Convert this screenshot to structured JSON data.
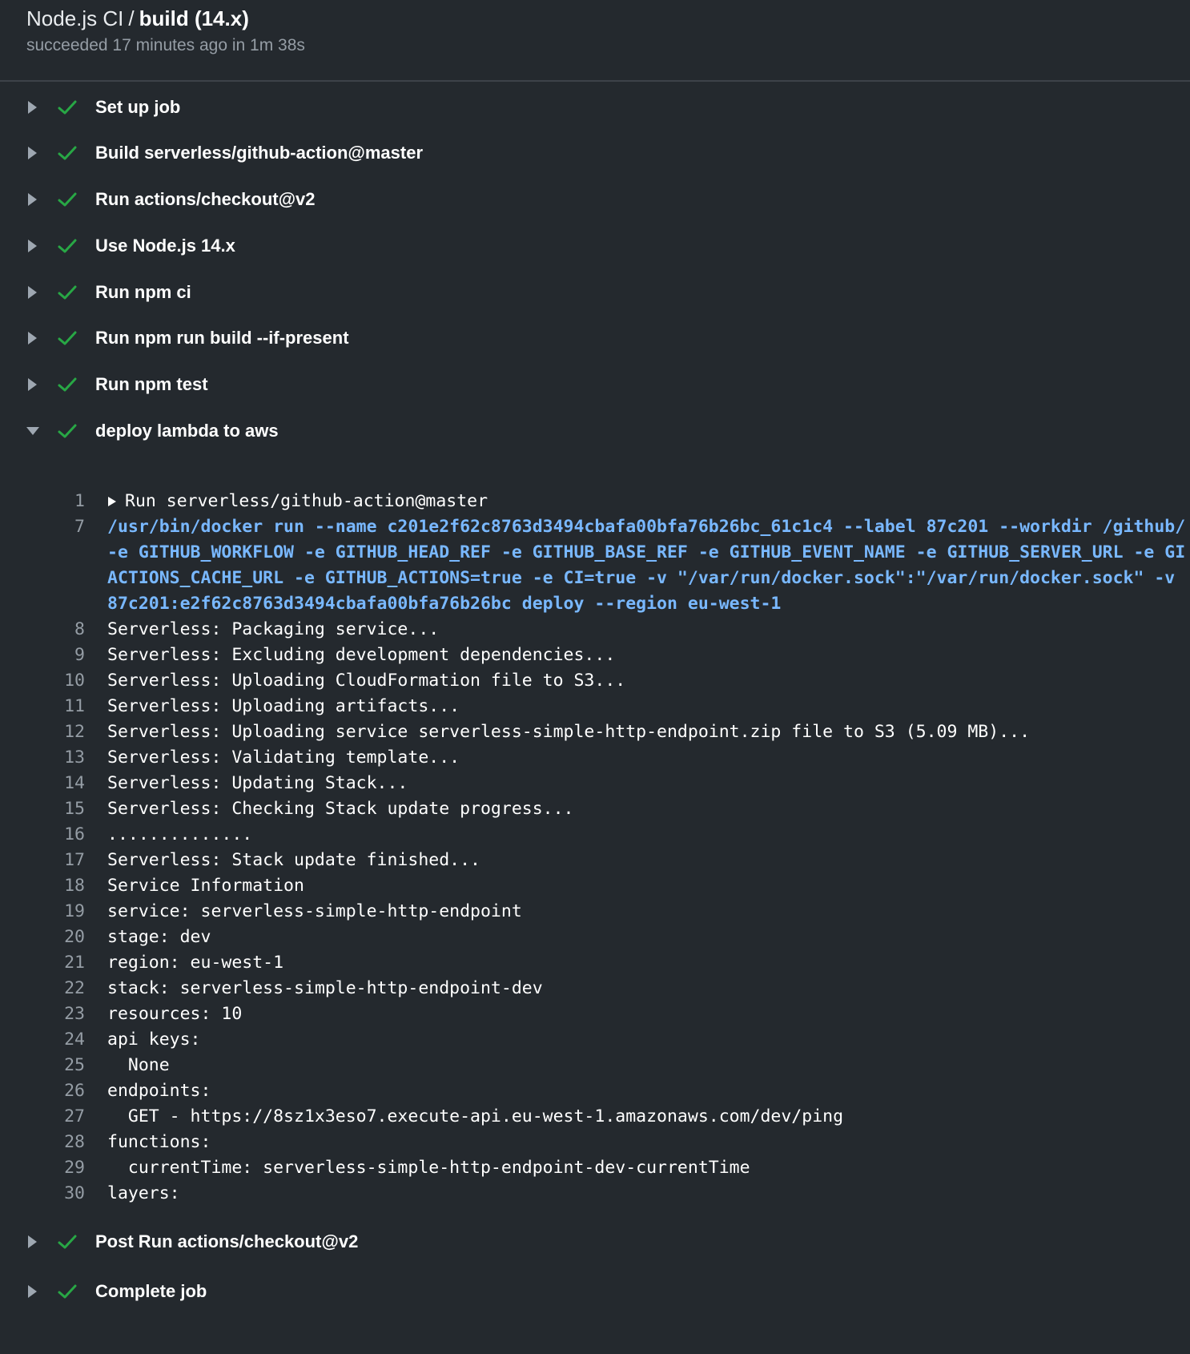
{
  "header": {
    "workflow": "Node.js CI",
    "separator": "/",
    "job": "build (14.x)",
    "status": "succeeded 17 minutes ago in 1m 38s"
  },
  "colors": {
    "background": "#24292e",
    "success_check": "#28a745",
    "command_text": "#79b8ff",
    "line_number": "#959da5"
  },
  "steps_before": [
    {
      "label": "Set up job",
      "status": "success",
      "expanded": false
    },
    {
      "label": "Build serverless/github-action@master",
      "status": "success",
      "expanded": false
    },
    {
      "label": "Run actions/checkout@v2",
      "status": "success",
      "expanded": false
    },
    {
      "label": "Use Node.js 14.x",
      "status": "success",
      "expanded": false
    },
    {
      "label": "Run npm ci",
      "status": "success",
      "expanded": false
    },
    {
      "label": "Run npm run build --if-present",
      "status": "success",
      "expanded": false
    },
    {
      "label": "Run npm test",
      "status": "success",
      "expanded": false
    }
  ],
  "expanded_step": {
    "label": "deploy lambda to aws",
    "status": "success",
    "expanded": true,
    "log": [
      {
        "n": "1",
        "text": "Run serverless/github-action@master",
        "kind": "group"
      },
      {
        "n": "7",
        "text": "/usr/bin/docker run --name c201e2f62c8763d3494cbafa00bfa76b26bc_61c1c4 --label 87c201 --workdir /github/",
        "kind": "cmd"
      },
      {
        "n": "",
        "text": "-e GITHUB_WORKFLOW -e GITHUB_HEAD_REF -e GITHUB_BASE_REF -e GITHUB_EVENT_NAME -e GITHUB_SERVER_URL -e GI",
        "kind": "cmd"
      },
      {
        "n": "",
        "text": "ACTIONS_CACHE_URL -e GITHUB_ACTIONS=true -e CI=true -v \"/var/run/docker.sock\":\"/var/run/docker.sock\" -v",
        "kind": "cmd"
      },
      {
        "n": "",
        "text": "87c201:e2f62c8763d3494cbafa00bfa76b26bc deploy --region eu-west-1",
        "kind": "cmd"
      },
      {
        "n": "8",
        "text": "Serverless: Packaging service...",
        "kind": "text"
      },
      {
        "n": "9",
        "text": "Serverless: Excluding development dependencies...",
        "kind": "text"
      },
      {
        "n": "10",
        "text": "Serverless: Uploading CloudFormation file to S3...",
        "kind": "text"
      },
      {
        "n": "11",
        "text": "Serverless: Uploading artifacts...",
        "kind": "text"
      },
      {
        "n": "12",
        "text": "Serverless: Uploading service serverless-simple-http-endpoint.zip file to S3 (5.09 MB)...",
        "kind": "text"
      },
      {
        "n": "13",
        "text": "Serverless: Validating template...",
        "kind": "text"
      },
      {
        "n": "14",
        "text": "Serverless: Updating Stack...",
        "kind": "text"
      },
      {
        "n": "15",
        "text": "Serverless: Checking Stack update progress...",
        "kind": "text"
      },
      {
        "n": "16",
        "text": "..............",
        "kind": "text"
      },
      {
        "n": "17",
        "text": "Serverless: Stack update finished...",
        "kind": "text"
      },
      {
        "n": "18",
        "text": "Service Information",
        "kind": "text"
      },
      {
        "n": "19",
        "text": "service: serverless-simple-http-endpoint",
        "kind": "text"
      },
      {
        "n": "20",
        "text": "stage: dev",
        "kind": "text"
      },
      {
        "n": "21",
        "text": "region: eu-west-1",
        "kind": "text"
      },
      {
        "n": "22",
        "text": "stack: serverless-simple-http-endpoint-dev",
        "kind": "text"
      },
      {
        "n": "23",
        "text": "resources: 10",
        "kind": "text"
      },
      {
        "n": "24",
        "text": "api keys:",
        "kind": "text"
      },
      {
        "n": "25",
        "text": "  None",
        "kind": "text"
      },
      {
        "n": "26",
        "text": "endpoints:",
        "kind": "text"
      },
      {
        "n": "27",
        "text": "  GET - https://8sz1x3eso7.execute-api.eu-west-1.amazonaws.com/dev/ping",
        "kind": "text"
      },
      {
        "n": "28",
        "text": "functions:",
        "kind": "text"
      },
      {
        "n": "29",
        "text": "  currentTime: serverless-simple-http-endpoint-dev-currentTime",
        "kind": "text"
      },
      {
        "n": "30",
        "text": "layers:",
        "kind": "text"
      }
    ]
  },
  "steps_after": [
    {
      "label": "Post Run actions/checkout@v2",
      "status": "success",
      "expanded": false
    },
    {
      "label": "Complete job",
      "status": "success",
      "expanded": false
    }
  ]
}
